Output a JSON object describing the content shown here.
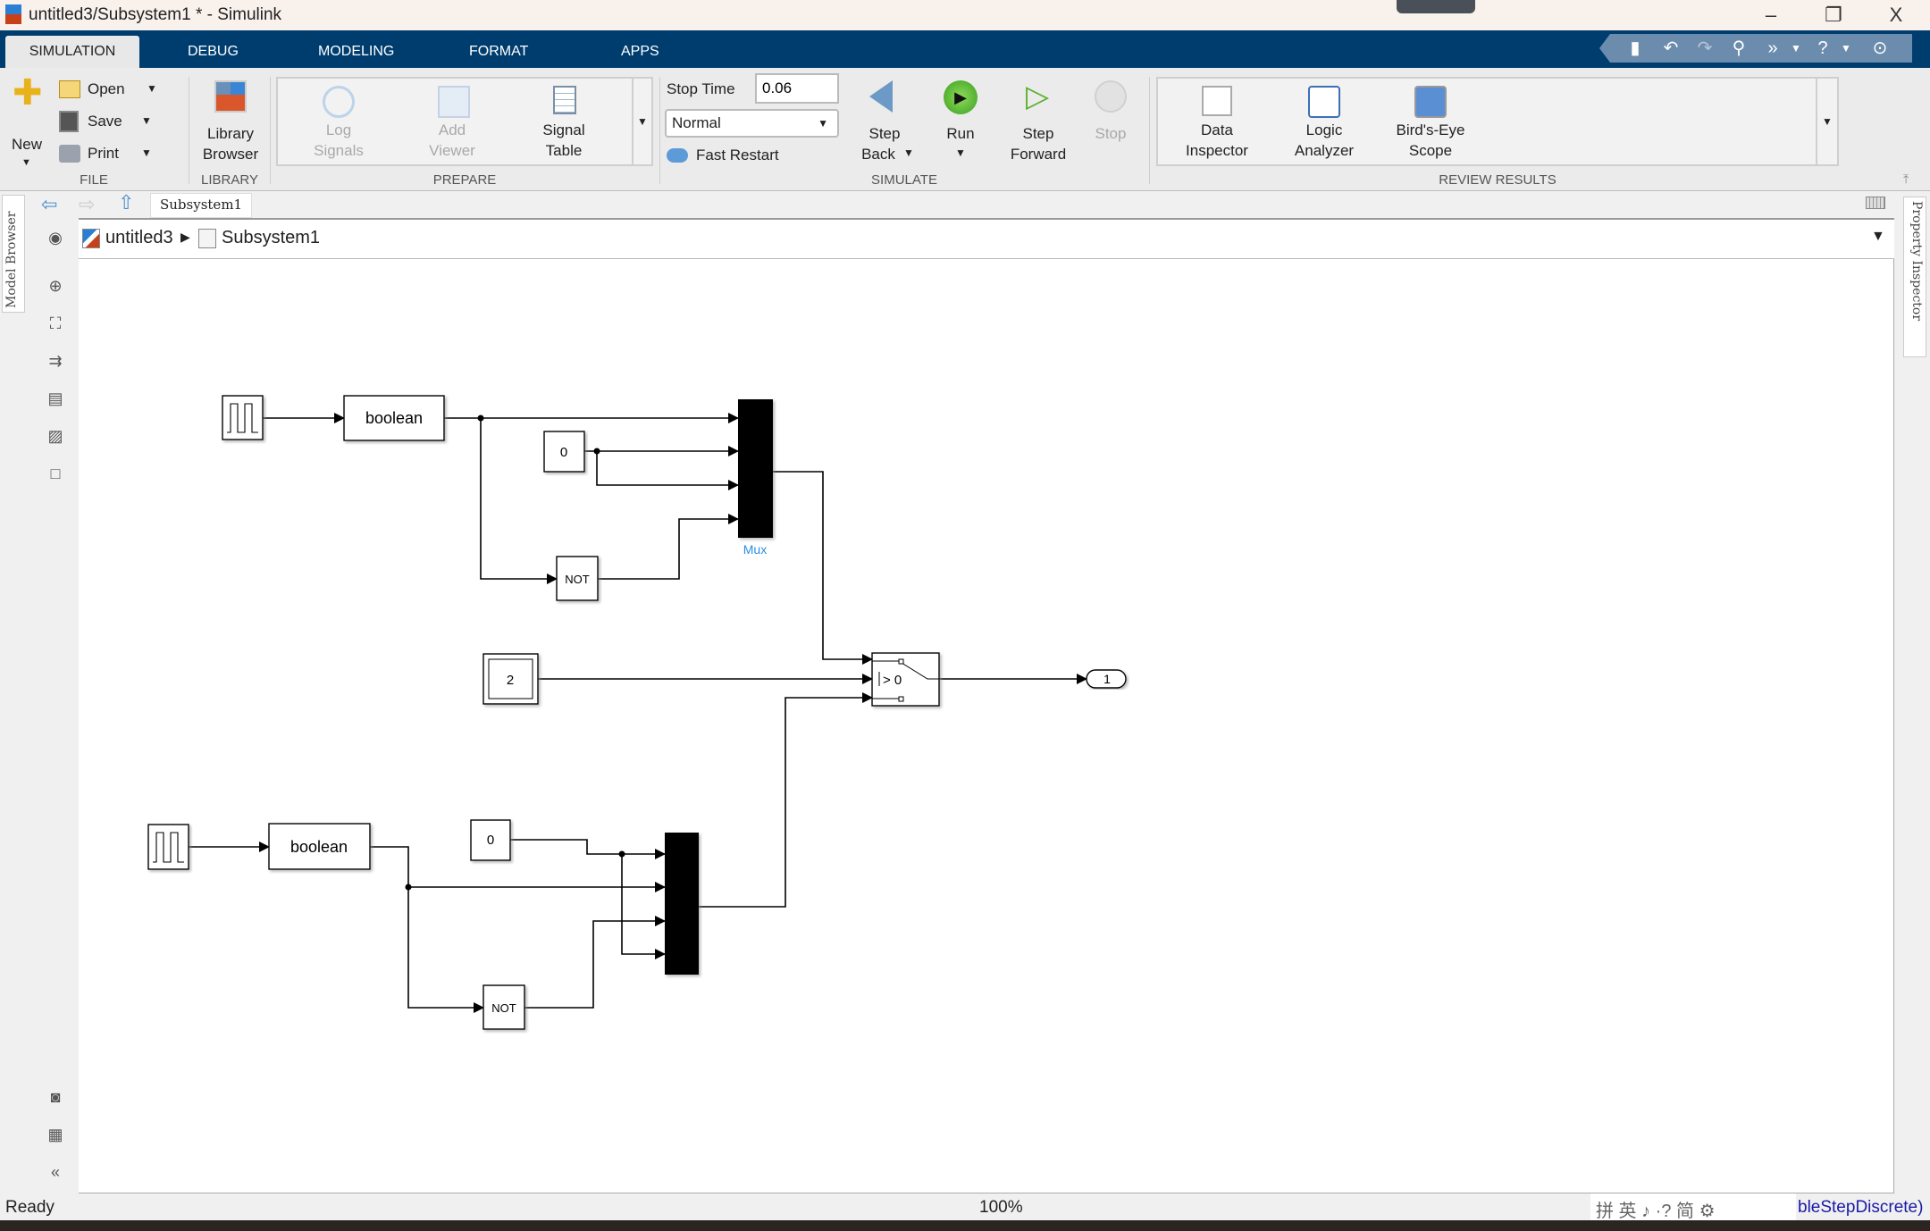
{
  "window": {
    "title": "untitled3/Subsystem1 * - Simulink",
    "minimize": "–",
    "restore": "❐",
    "close": "X"
  },
  "tabs": [
    {
      "label": "SIMULATION",
      "active": true
    },
    {
      "label": "DEBUG"
    },
    {
      "label": "MODELING"
    },
    {
      "label": "FORMAT"
    },
    {
      "label": "APPS"
    }
  ],
  "ribbon": {
    "file": {
      "section": "FILE",
      "new": "New",
      "open": "Open",
      "save": "Save",
      "print": "Print"
    },
    "library": {
      "section": "LIBRARY",
      "browser_l1": "Library",
      "browser_l2": "Browser"
    },
    "prepare": {
      "section": "PREPARE",
      "log_l1": "Log",
      "log_l2": "Signals",
      "add_l1": "Add",
      "add_l2": "Viewer",
      "sig_l1": "Signal",
      "sig_l2": "Table"
    },
    "simulate": {
      "section": "SIMULATE",
      "stop_time_label": "Stop Time",
      "stop_time_value": "0.06",
      "mode": "Normal",
      "fast_restart": "Fast Restart",
      "step_back_l1": "Step",
      "step_back_l2": "Back",
      "run": "Run",
      "step_fwd_l1": "Step",
      "step_fwd_l2": "Forward",
      "stop": "Stop"
    },
    "review": {
      "section": "REVIEW RESULTS",
      "di_l1": "Data",
      "di_l2": "Inspector",
      "la_l1": "Logic",
      "la_l2": "Analyzer",
      "be_l1": "Bird's-Eye",
      "be_l2": "Scope"
    }
  },
  "nav": {
    "tab": "Subsystem1"
  },
  "breadcrumb": [
    "untitled3",
    "Subsystem1"
  ],
  "side": {
    "left": "Model Browser",
    "right": "Property Inspector"
  },
  "diagram": {
    "top": {
      "convert": "boolean",
      "const0": "0",
      "not": "NOT",
      "mux_label": "Mux"
    },
    "const2": "2",
    "switch": "> 0",
    "outport": "1",
    "bottom": {
      "convert": "boolean",
      "const0": "0",
      "not": "NOT"
    }
  },
  "status": {
    "left": "Ready",
    "zoom": "100%",
    "right": "bleStepDiscrete)",
    "ime": "拼 英 ♪ ·? 简 ⚙"
  },
  "colors": {
    "tabbar": "#003d6f",
    "mux_label": "#2a8fe0"
  }
}
